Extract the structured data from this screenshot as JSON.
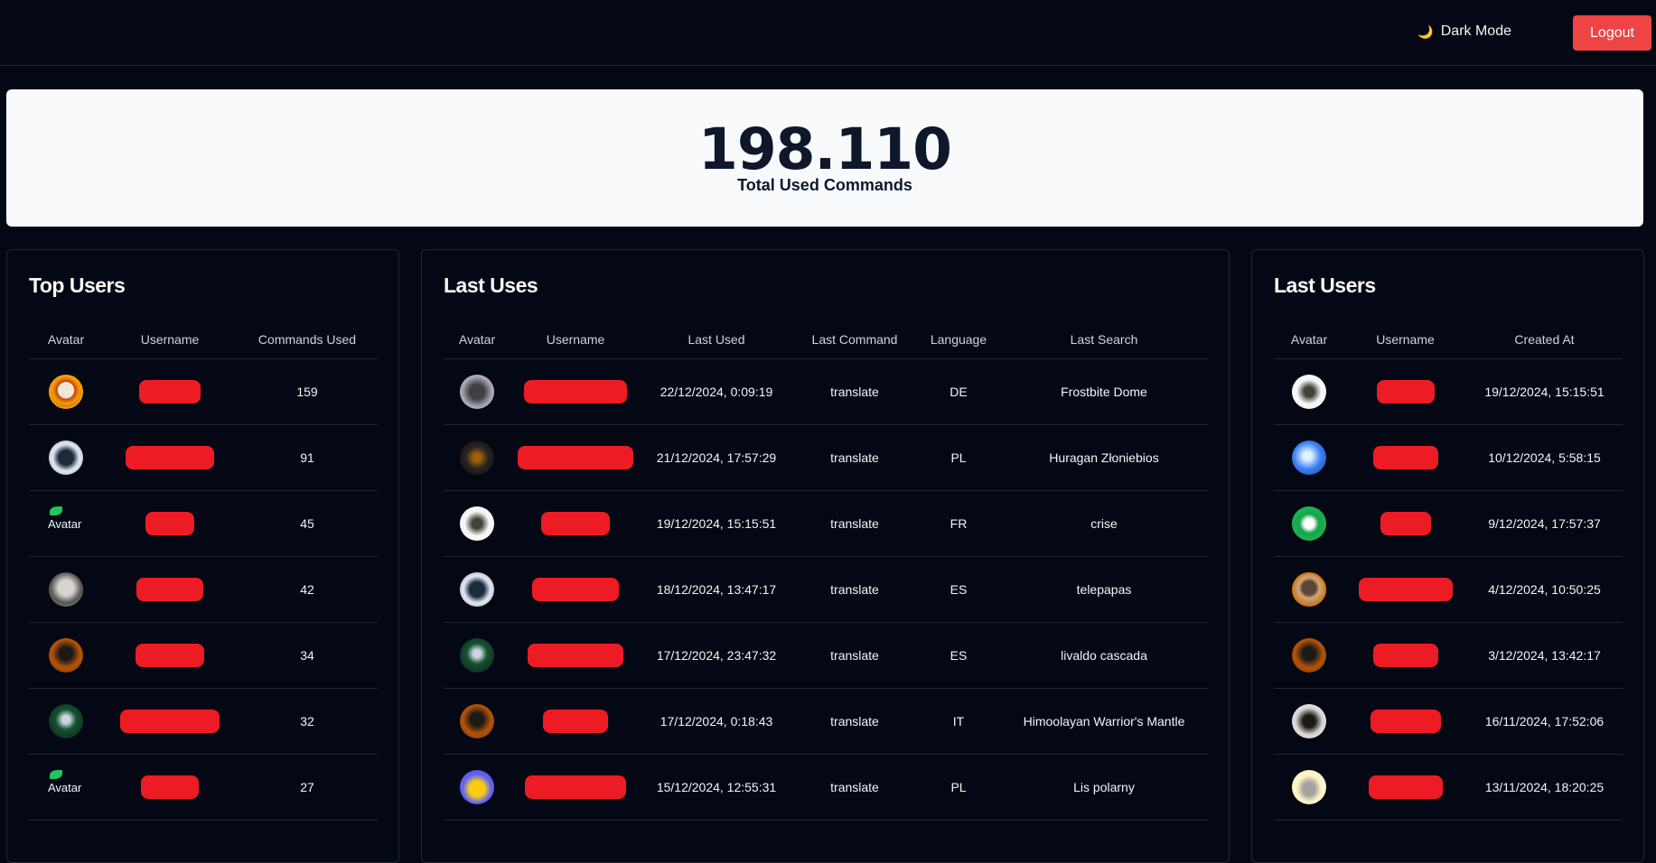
{
  "header": {
    "dark_mode_label": "Dark Mode",
    "dark_mode_icon": "🌙",
    "logout_label": "Logout"
  },
  "stats": {
    "total": "198.110",
    "label": "Total Used Commands"
  },
  "top_users": {
    "title": "Top Users",
    "columns": [
      "Avatar",
      "Username",
      "Commands Used"
    ],
    "rows": [
      {
        "avatar": "avatar-anime",
        "commands": "159"
      },
      {
        "avatar": "avatar-wolf",
        "commands": "91"
      },
      {
        "avatar": "broken",
        "alt": "Avatar",
        "commands": "45"
      },
      {
        "avatar": "avatar-person",
        "commands": "42"
      },
      {
        "avatar": "avatar-guitar",
        "commands": "34"
      },
      {
        "avatar": "avatar-skull",
        "commands": "32"
      },
      {
        "avatar": "broken",
        "alt": "Avatar",
        "commands": "27"
      }
    ]
  },
  "last_uses": {
    "title": "Last Uses",
    "columns": [
      "Avatar",
      "Username",
      "Last Used",
      "Last Command",
      "Language",
      "Last Search"
    ],
    "rows": [
      {
        "avatar": "avatar-face",
        "last_used": "22/12/2024, 0:09:19",
        "command": "translate",
        "language": "DE",
        "search": "Frostbite Dome"
      },
      {
        "avatar": "avatar-warrior",
        "last_used": "21/12/2024, 17:57:29",
        "command": "translate",
        "language": "PL",
        "search": "Huragan Złoniebios"
      },
      {
        "avatar": "avatar-sketch",
        "last_used": "19/12/2024, 15:15:51",
        "command": "translate",
        "language": "FR",
        "search": "crise"
      },
      {
        "avatar": "avatar-wolf",
        "last_used": "18/12/2024, 13:47:17",
        "command": "translate",
        "language": "ES",
        "search": "telepapas"
      },
      {
        "avatar": "avatar-skull",
        "last_used": "17/12/2024, 23:47:32",
        "command": "translate",
        "language": "ES",
        "search": "livaldo cascada"
      },
      {
        "avatar": "avatar-guitar",
        "last_used": "17/12/2024, 0:18:43",
        "command": "translate",
        "language": "IT",
        "search": "Himoolayan Warrior's Mantle"
      },
      {
        "avatar": "avatar-duck",
        "last_used": "15/12/2024, 12:55:31",
        "command": "translate",
        "language": "PL",
        "search": "Lis polarny"
      }
    ]
  },
  "last_users": {
    "title": "Last Users",
    "columns": [
      "Avatar",
      "Username",
      "Created At"
    ],
    "rows": [
      {
        "avatar": "avatar-sketch",
        "created": "19/12/2024, 15:15:51"
      },
      {
        "avatar": "avatar-blue",
        "created": "10/12/2024, 5:58:15"
      },
      {
        "avatar": "avatar-green",
        "created": "9/12/2024, 17:57:37"
      },
      {
        "avatar": "avatar-anime2",
        "created": "4/12/2024, 10:50:25"
      },
      {
        "avatar": "avatar-guitar",
        "created": "3/12/2024, 13:42:17"
      },
      {
        "avatar": "avatar-dark",
        "created": "16/11/2024, 17:52:06"
      },
      {
        "avatar": "avatar-car",
        "created": "13/11/2024, 18:20:25"
      }
    ]
  },
  "colors": {
    "background": "#040814",
    "card": "#f8fafc",
    "logout": "#ef4444",
    "redaction": "#ed1c24"
  }
}
